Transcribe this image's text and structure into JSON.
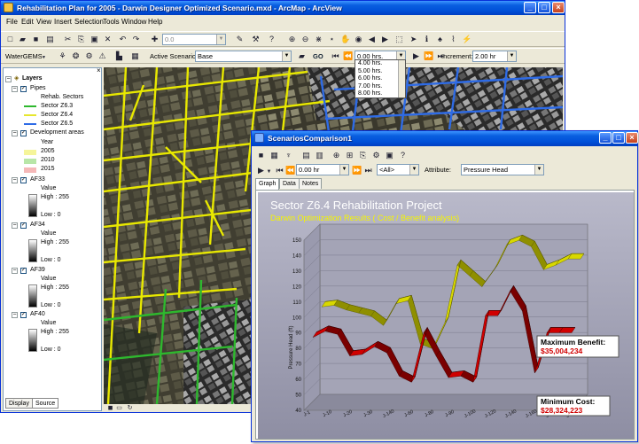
{
  "main_window": {
    "title": "Rehabilitation Plan for 2005 - Darwin Designer Optimized Scenario.mxd - ArcMap - ArcView",
    "menu": [
      "File",
      "Edit",
      "View",
      "Insert",
      "Selection",
      "Tools",
      "Window",
      "Help"
    ],
    "scale_value": "0.0",
    "watergems_label": "WaterGEMS",
    "active_scenario_label": "Active Scenario",
    "active_scenario_value": "Base",
    "go_label": "GO",
    "time_value": "0.00 hrs.",
    "increment_label": "Increment:",
    "increment_value": "2.00 hr",
    "time_options": [
      "4.00 hrs.",
      "5.00 hrs.",
      "6.00 hrs.",
      "7.00 hrs.",
      "8.00 hrs."
    ]
  },
  "toc": {
    "root": "Layers",
    "pipes": {
      "name": "Pipes",
      "sublabel": "Rehab. Sectors",
      "items": [
        {
          "label": "Sector Z6.3",
          "color": "#2eb82e"
        },
        {
          "label": "Sector Z6.4",
          "color": "#e6e62e"
        },
        {
          "label": "Sector Z6.5",
          "color": "#2e6be6"
        }
      ]
    },
    "dev_areas": {
      "name": "Development areas",
      "sublabel": "Year",
      "items": [
        {
          "label": "2005",
          "color": "#f5f59a"
        },
        {
          "label": "2010",
          "color": "#b8e6a8"
        },
        {
          "label": "2015",
          "color": "#f5b8b8"
        }
      ]
    },
    "rasters": [
      {
        "name": "AF33",
        "value": "Value",
        "high": "High : 255",
        "low": "Low : 0"
      },
      {
        "name": "AF34",
        "value": "Value",
        "high": "High : 255",
        "low": "Low : 0"
      },
      {
        "name": "AF39",
        "value": "Value",
        "high": "High : 255",
        "low": "Low : 0"
      },
      {
        "name": "AF40",
        "value": "Value",
        "high": "High : 255",
        "low": "Low : 0"
      }
    ],
    "tabs": [
      "Display",
      "Source"
    ]
  },
  "scenario_window": {
    "title": "ScenariosComparison1",
    "time_value": "0.00 hr",
    "all_option": "<All>",
    "attribute_label": "Attribute:",
    "attribute_value": "Pressure Head",
    "tabs": [
      "Graph",
      "Data",
      "Notes"
    ],
    "annotations": {
      "max_label": "Maximum Benefit:",
      "max_value": "$35,004,234",
      "min_label": "Minimum Cost:",
      "min_value": "$28,324,223"
    }
  },
  "chart_data": {
    "type": "line",
    "title": "Sector Z6.4 Rehabilitation Project",
    "subtitle": "Darwin Optimization Results ( Cost / Benefit analysis)",
    "ylabel": "Pressure Head (ft)",
    "ylim": [
      40,
      150
    ],
    "yticks": [
      40,
      50,
      60,
      70,
      80,
      90,
      100,
      110,
      120,
      130,
      140,
      150
    ],
    "categories": [
      "J-1",
      "J-10",
      "J-20",
      "J-30",
      "J-140",
      "J-60",
      "J-80",
      "J-90",
      "J-100",
      "J-120",
      "J-140",
      "J-160",
      "J-180",
      "J-200"
    ],
    "x_tick_labels": [
      "J-1",
      "J-10",
      "J-20",
      "J-30",
      "J-140",
      "J-60",
      "J-80",
      "J-90",
      "J-100",
      "J-120",
      "J-140",
      "J-160",
      "J-180",
      "J-200"
    ],
    "series": [
      {
        "color": "#b0b000",
        "values": [
          100,
          101,
          98,
          96,
          94,
          88,
          102,
          104,
          76,
          73,
          90,
          127,
          120,
          113,
          124,
          140,
          143,
          139,
          124,
          127,
          131,
          131
        ]
      },
      {
        "color": "#b00000",
        "values": [
          86,
          90,
          88,
          74,
          75,
          80,
          76,
          61,
          57,
          89,
          74,
          60,
          61,
          57,
          100,
          100,
          116,
          103,
          63,
          89,
          89,
          89
        ]
      }
    ]
  }
}
